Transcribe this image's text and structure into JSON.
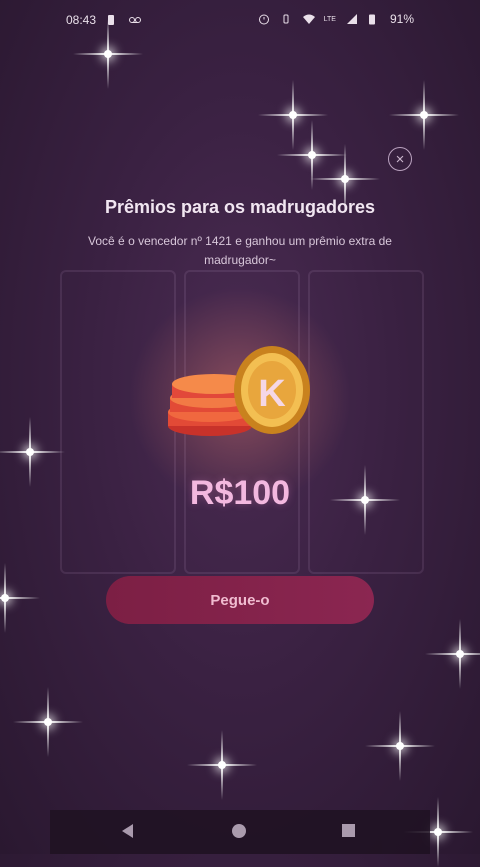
{
  "status_bar": {
    "time": "08:43",
    "network_label": "LTE",
    "battery": "91%"
  },
  "dialog": {
    "title": "Prêmios para os madrugadores",
    "description": "Você é o vencedor nº 1421 e ganhou um prêmio extra de madrugador~",
    "amount": "R$100",
    "cta_label": "Pegue-o",
    "close_icon": "close-icon",
    "coin_letter": "K"
  },
  "nav_bar": {
    "icons": [
      "back-icon",
      "home-icon",
      "recents-icon"
    ]
  },
  "colors": {
    "background": "#3a2142",
    "amount": "#f3b8df",
    "cta": "#8b2651"
  }
}
